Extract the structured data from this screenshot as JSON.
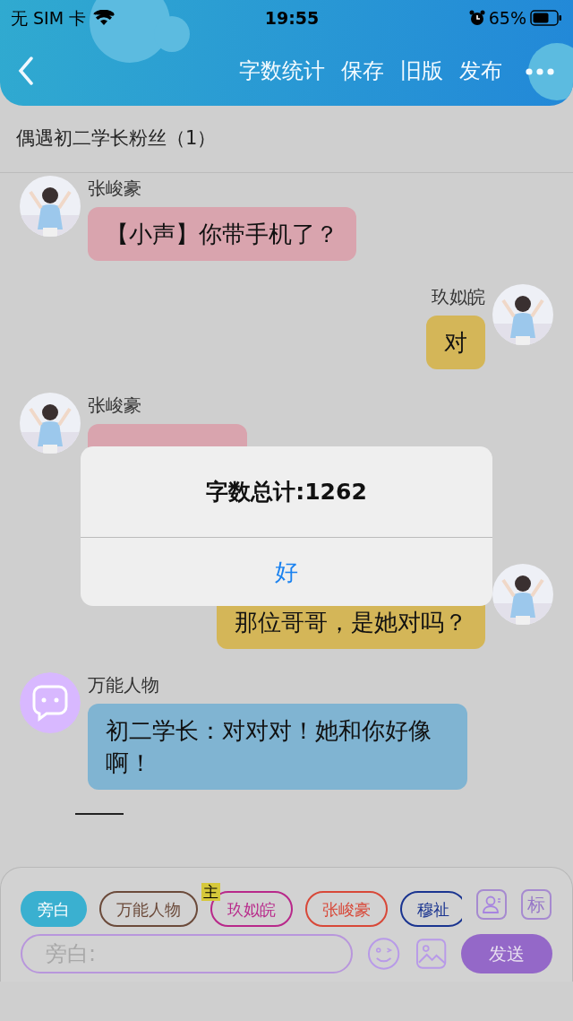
{
  "status_bar": {
    "carrier": "无 SIM 卡",
    "time": "19:55",
    "battery": "65%"
  },
  "header": {
    "actions": [
      "字数统计",
      "保存",
      "旧版",
      "发布"
    ]
  },
  "chat_title": "偶遇初二学长粉丝（1）",
  "messages": [
    {
      "kind": "character",
      "outgoing": false,
      "name": "张峻豪",
      "text": "【小声】你带手机了？",
      "color": "#d9a4ae"
    },
    {
      "kind": "character",
      "outgoing": true,
      "name": "玖姒皖",
      "text": "对",
      "color": "#d4b658"
    },
    {
      "kind": "character",
      "outgoing": false,
      "name": "张峻豪",
      "color": "#d9a4ae"
    },
    {
      "kind": "character",
      "outgoing": true,
      "text": "那位哥哥，是她对吗？",
      "color": "#d4b658"
    },
    {
      "kind": "universal",
      "outgoing": false,
      "name": "万能人物",
      "text": "初二学长：对对对！她和你好像啊！",
      "color": "#80b4d2"
    }
  ],
  "roles": [
    {
      "label": "旁白",
      "selected": true,
      "color": "#3ab0d0"
    },
    {
      "label": "万能人物",
      "selected": false,
      "color": "#6b4a3a"
    },
    {
      "label": "玖姒皖",
      "selected": false,
      "color": "#b8288a",
      "badge": "主"
    },
    {
      "label": "张峻豪",
      "selected": false,
      "color": "#d84838"
    },
    {
      "label": "穆祉",
      "selected": false,
      "color": "#1a3490"
    }
  ],
  "tag_button": "标",
  "input": {
    "placeholder": "旁白:"
  },
  "send_button": "发送",
  "alert": {
    "title": "字数总计:1262",
    "button": "好"
  }
}
